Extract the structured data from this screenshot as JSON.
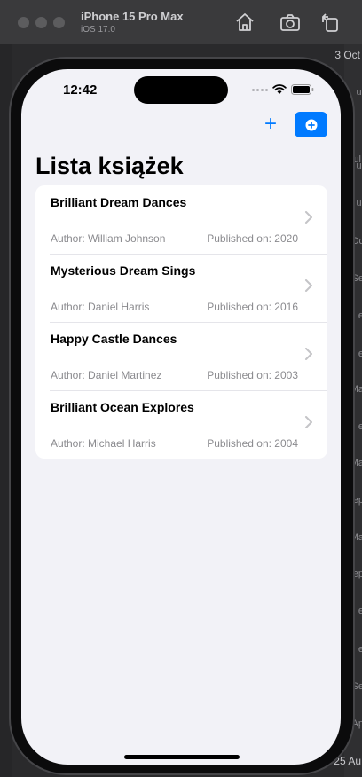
{
  "simulator": {
    "device_name": "iPhone 15 Pro Max",
    "os_version": "iOS 17.0"
  },
  "background": {
    "right_labels": [
      "3 Oct",
      "ul",
      "ul",
      "ul",
      "Oc",
      "Se",
      "e",
      "e",
      "Ma",
      "e",
      "Ma",
      "ep",
      "Ma",
      "ep",
      "e",
      "e",
      "e",
      "Se",
      "Ap",
      "25 Au"
    ]
  },
  "status_bar": {
    "time": "12:42"
  },
  "nav": {
    "title": "Lista książek",
    "plus_label": "+"
  },
  "books": [
    {
      "title": "Brilliant Dream Dances",
      "author": "Author: William Johnson",
      "published": "Published on: 2020"
    },
    {
      "title": "Mysterious Dream Sings",
      "author": "Author: Daniel Harris",
      "published": "Published on: 2016"
    },
    {
      "title": "Happy Castle Dances",
      "author": "Author: Daniel Martinez",
      "published": "Published on: 2003"
    },
    {
      "title": "Brilliant Ocean Explores",
      "author": "Author: Michael Harris",
      "published": "Published on: 2004"
    }
  ],
  "colors": {
    "accent": "#007aff",
    "background": "#f2f2f7",
    "secondary_text": "#8a8a8e"
  }
}
